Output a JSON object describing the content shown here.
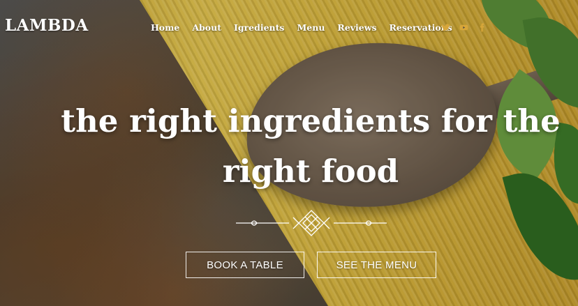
{
  "brand": {
    "name": "LAMBDA"
  },
  "nav": {
    "items": [
      {
        "label": "Home"
      },
      {
        "label": "About"
      },
      {
        "label": "Igredients"
      },
      {
        "label": "Menu"
      },
      {
        "label": "Reviews"
      },
      {
        "label": "Reservations"
      }
    ]
  },
  "social": {
    "icons": [
      "twitter-icon",
      "youtube-icon",
      "facebook-icon"
    ],
    "color": "#d7a63a"
  },
  "hero": {
    "headline": "the right ingredients for the right food",
    "buttons": {
      "book_label": "BOOK A TABLE",
      "menu_label": "SEE THE MENU"
    }
  },
  "colors": {
    "text": "#ffffff",
    "accent": "#d7a63a"
  }
}
